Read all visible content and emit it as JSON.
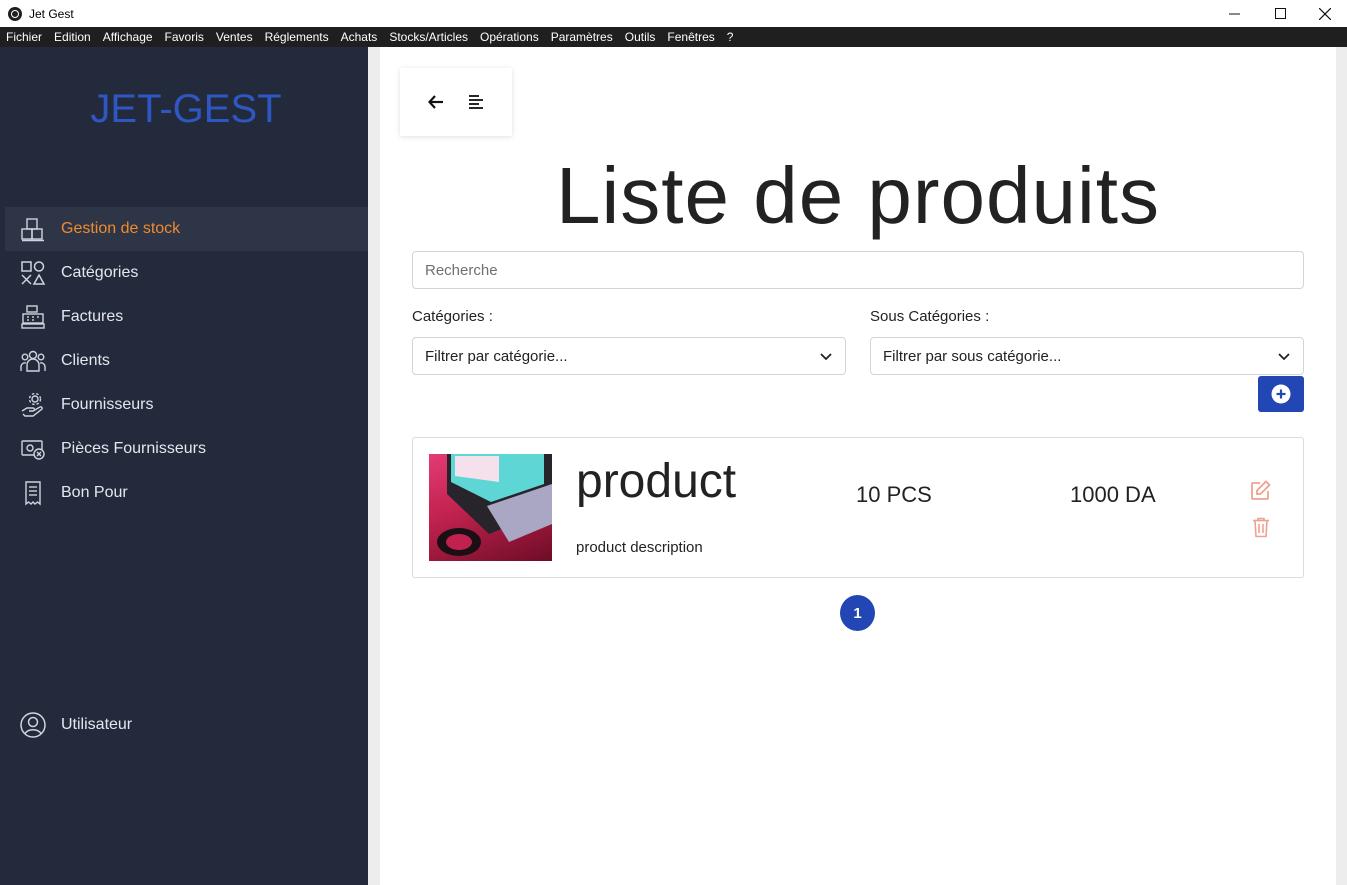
{
  "window": {
    "title": "Jet Gest",
    "controls": [
      "minimize-icon",
      "maximize-icon",
      "close-icon"
    ]
  },
  "menubar": {
    "items": [
      "Fichier",
      "Edition",
      "Affichage",
      "Favoris",
      "Ventes",
      "Réglements",
      "Achats",
      "Stocks/Articles",
      "Opérations",
      "Paramètres",
      "Outils",
      "Fenêtres",
      "?"
    ]
  },
  "sidebar": {
    "brand": "JET-GEST",
    "items": [
      {
        "label": "Gestion de stock",
        "icon": "boxes-icon",
        "active": true
      },
      {
        "label": "Catégories",
        "icon": "shapes-icon",
        "active": false
      },
      {
        "label": "Factures",
        "icon": "cash-register-icon",
        "active": false
      },
      {
        "label": "Clients",
        "icon": "users-icon",
        "active": false
      },
      {
        "label": "Fournisseurs",
        "icon": "hand-gear-icon",
        "active": false
      },
      {
        "label": "Pièces Fournisseurs",
        "icon": "money-cancel-icon",
        "active": false
      },
      {
        "label": "Bon Pour",
        "icon": "receipt-icon",
        "active": false
      }
    ],
    "user": {
      "label": "Utilisateur",
      "icon": "user-circle-icon"
    }
  },
  "toolbar": {
    "back_icon": "arrow-left-icon",
    "menu_icon": "align-left-icon"
  },
  "main": {
    "title": "Liste de produits",
    "search_placeholder": "Recherche",
    "filters": {
      "categories_label": "Catégories :",
      "categories_value": "Filtrer par catégorie...",
      "subcategories_label": "Sous Catégories :",
      "subcategories_value": "Filtrer par sous catégorie..."
    },
    "add_icon": "plus-circle-icon",
    "products": [
      {
        "name": "product",
        "description": "product description",
        "quantity": "10 PCS",
        "price": "1000 DA"
      }
    ],
    "pagination": {
      "current": "1"
    }
  },
  "colors": {
    "sidebar_bg": "#232a3b",
    "sidebar_active_bg": "#2e3546",
    "active_text": "#f08a2e",
    "brand": "#2f57c4",
    "primary": "#2246b3",
    "action_icon": "#f0a090"
  }
}
